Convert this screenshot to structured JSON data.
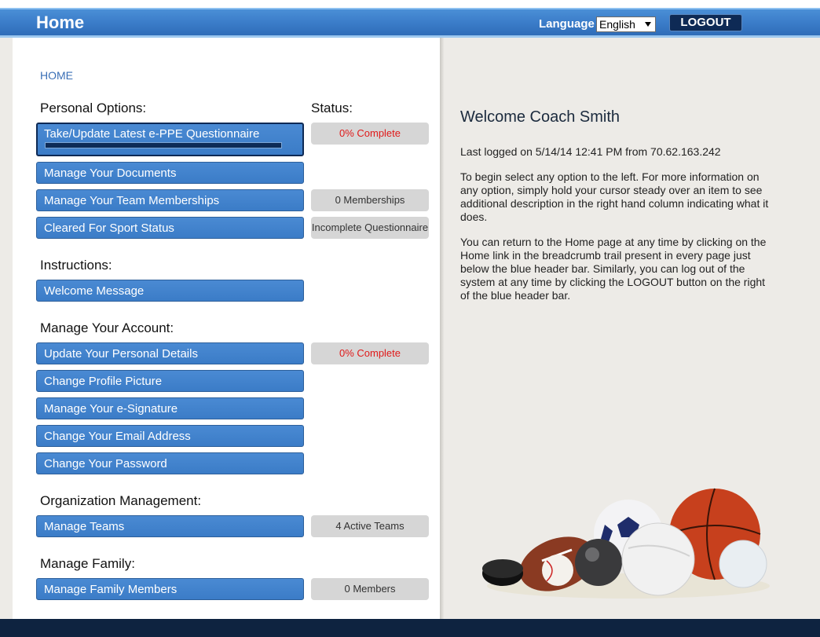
{
  "header": {
    "title": "Home",
    "language_label": "Language",
    "language_value": "English",
    "logout_label": "LOGOUT"
  },
  "breadcrumb": "HOME",
  "personal": {
    "heading": "Personal Options:",
    "status_heading": "Status:",
    "items": [
      {
        "label": "Take/Update Latest e-PPE Questionnaire",
        "status": "0% Complete"
      },
      {
        "label": "Manage Your Documents",
        "status": ""
      },
      {
        "label": "Manage Your Team Memberships",
        "status": "0 Memberships"
      },
      {
        "label": "Cleared For Sport Status",
        "status": "Incomplete Questionnaire"
      }
    ]
  },
  "instructions": {
    "heading": "Instructions:",
    "items": [
      {
        "label": "Welcome Message"
      }
    ]
  },
  "account": {
    "heading": "Manage Your Account:",
    "items": [
      {
        "label": "Update Your Personal Details",
        "status": "0% Complete"
      },
      {
        "label": "Change Profile Picture"
      },
      {
        "label": "Manage Your e-Signature"
      },
      {
        "label": "Change Your Email Address"
      },
      {
        "label": "Change Your Password"
      }
    ]
  },
  "organization": {
    "heading": "Organization Management:",
    "items": [
      {
        "label": "Manage Teams",
        "status": "4 Active Teams"
      }
    ]
  },
  "family": {
    "heading": "Manage Family:",
    "items": [
      {
        "label": "Manage Family Members",
        "status": "0 Members"
      }
    ]
  },
  "welcome": {
    "title": "Welcome Coach Smith",
    "last_logged": "Last logged on 5/14/14 12:41 PM from 70.62.163.242",
    "para1": "To begin select any option to the left. For more information on any option, simply hold your cursor steady over an item to see additional description in the right hand column indicating what it does.",
    "para2": "You can return to the Home page at any time by clicking on the Home link in the breadcrumb trail present in every page just below the blue header bar. Similarly, you can log out of the system at any time by clicking the LOGOUT button on the right of the blue header bar."
  },
  "colors": {
    "header_blue": "#3a7bc8",
    "button_blue": "#3b7cc7",
    "dark_navy": "#0e2a55",
    "status_red": "#e01a1a"
  },
  "progress": {
    "eppe_fraction": 0.0
  }
}
